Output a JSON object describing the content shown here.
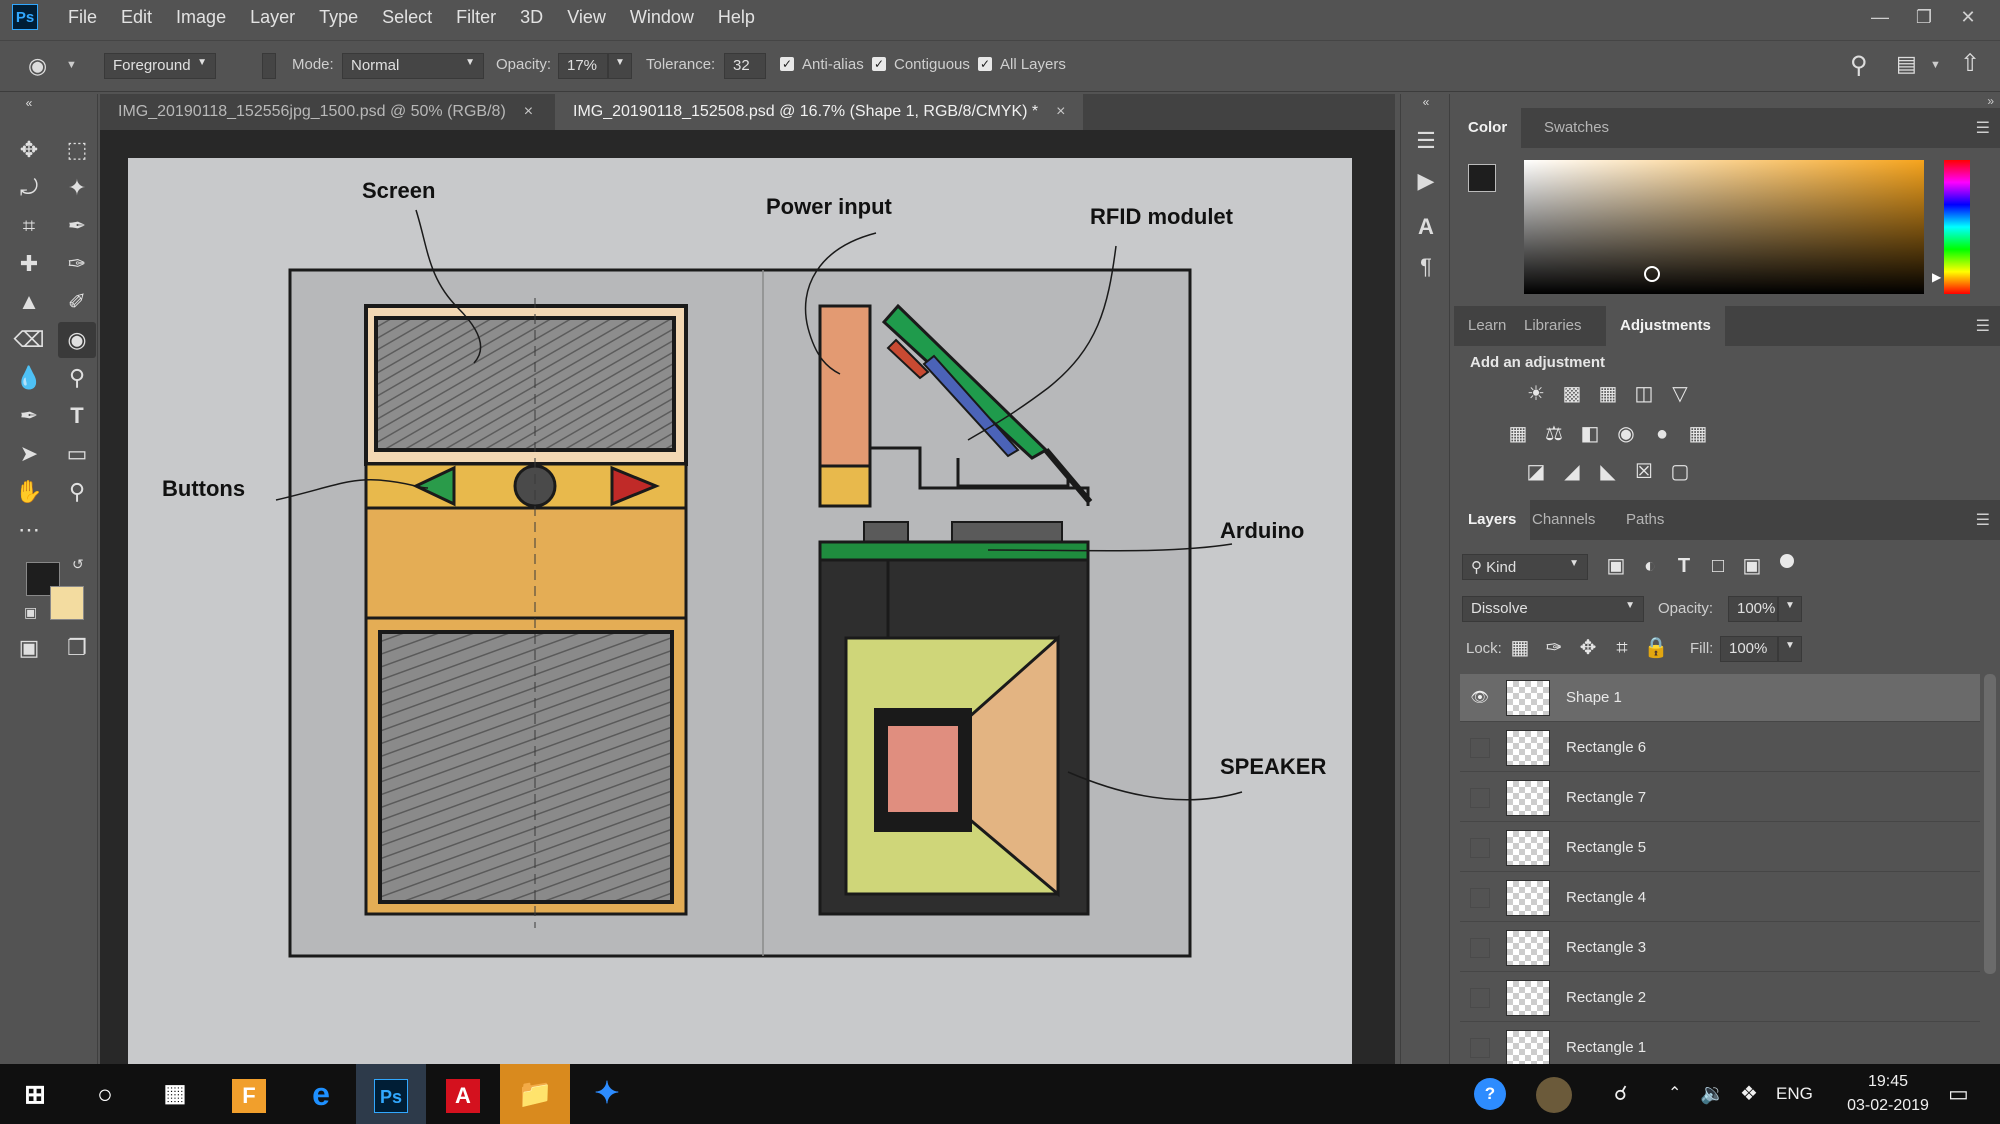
{
  "app": {
    "logo": "Ps",
    "menu": [
      "File",
      "Edit",
      "Image",
      "Layer",
      "Type",
      "Select",
      "Filter",
      "3D",
      "View",
      "Window",
      "Help"
    ],
    "window_controls": [
      "minimize-icon",
      "restore-icon",
      "close-icon"
    ]
  },
  "options": {
    "fill_source": "Foreground",
    "mode_label": "Mode:",
    "mode_value": "Normal",
    "opacity_label": "Opacity:",
    "opacity_value": "17%",
    "tolerance_label": "Tolerance:",
    "tolerance_value": "32",
    "antialias_label": "Anti-alias",
    "contiguous_label": "Contiguous",
    "all_layers_label": "All Layers",
    "antialias_checked": true,
    "contiguous_checked": true,
    "all_layers_checked": true
  },
  "tabs": [
    {
      "label": "IMG_20190118_152556jpg_1500.psd @ 50% (RGB/8)",
      "active": false
    },
    {
      "label": "IMG_20190118_152508.psd @ 16.7% (Shape 1, RGB/8/CMYK) *",
      "active": true
    }
  ],
  "tab_close": "×",
  "sketch": {
    "labels": {
      "screen": "Screen",
      "power_input": "Power input",
      "rfid": "RFID modulet",
      "buttons": "Buttons",
      "arduino": "Arduino",
      "speaker": "SPEAKER"
    }
  },
  "color_panel": {
    "tabs": [
      "Color",
      "Swatches"
    ],
    "foreground_color": "#1e1e1e",
    "background_color": "#f3dca0",
    "hue_color": "#f6a41d"
  },
  "adjust_panel": {
    "tabs": [
      "Learn",
      "Libraries",
      "Adjustments"
    ],
    "heading": "Add an adjustment"
  },
  "layers_panel": {
    "tabs": [
      "Layers",
      "Channels",
      "Paths"
    ],
    "filter_kind": "Kind",
    "blend_mode": "Dissolve",
    "opacity_label": "Opacity:",
    "opacity_value": "100%",
    "lock_label": "Lock:",
    "fill_label": "Fill:",
    "fill_value": "100%",
    "layers": [
      {
        "name": "Shape 1",
        "visible": true,
        "selected": true
      },
      {
        "name": "Rectangle 6",
        "visible": false,
        "selected": false
      },
      {
        "name": "Rectangle 7",
        "visible": false,
        "selected": false
      },
      {
        "name": "Rectangle 5",
        "visible": false,
        "selected": false
      },
      {
        "name": "Rectangle 4",
        "visible": false,
        "selected": false
      },
      {
        "name": "Rectangle 3",
        "visible": false,
        "selected": false
      },
      {
        "name": "Rectangle 2",
        "visible": false,
        "selected": false
      },
      {
        "name": "Rectangle 1",
        "visible": false,
        "selected": false
      }
    ]
  },
  "taskbar": {
    "language": "ENG",
    "time": "19:45",
    "date": "03-02-2019"
  }
}
